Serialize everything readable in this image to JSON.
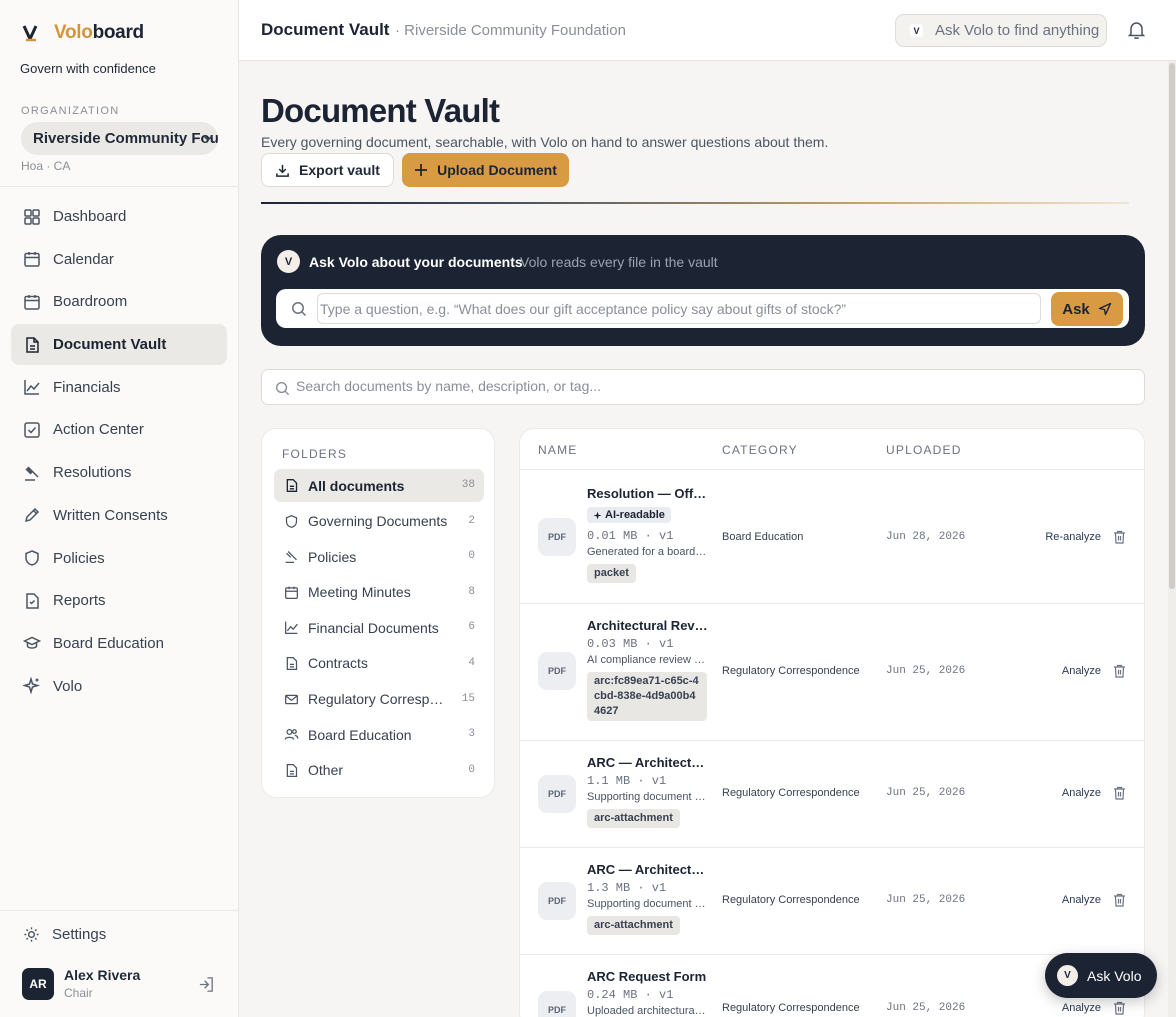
{
  "brand": {
    "name_accent": "Volo",
    "name_rest": "board",
    "tagline": "Govern with confidence"
  },
  "org": {
    "label": "ORGANIZATION",
    "name": "Riverside Community Foundation",
    "sub": "Hoa · CA"
  },
  "nav": [
    {
      "label": "Dashboard",
      "icon": "dashboard-icon"
    },
    {
      "label": "Calendar",
      "icon": "calendar-icon"
    },
    {
      "label": "Boardroom",
      "icon": "boardroom-icon"
    },
    {
      "label": "Document Vault",
      "icon": "document-icon",
      "active": true
    },
    {
      "label": "Financials",
      "icon": "chart-icon"
    },
    {
      "label": "Action Center",
      "icon": "checkbox-icon"
    },
    {
      "label": "Resolutions",
      "icon": "gavel-icon"
    },
    {
      "label": "Written Consents",
      "icon": "pen-icon"
    },
    {
      "label": "Policies",
      "icon": "shield-icon"
    },
    {
      "label": "Reports",
      "icon": "report-icon"
    },
    {
      "label": "Board Education",
      "icon": "graduation-cap-icon"
    },
    {
      "label": "Volo",
      "icon": "sparkle-icon"
    }
  ],
  "settings_label": "Settings",
  "user": {
    "initials": "AR",
    "name": "Alex Rivera",
    "role": "Chair"
  },
  "topbar": {
    "title": "Document Vault",
    "crumb": "· Riverside Community Foundation",
    "search_label": "Ask Volo to find anything",
    "search_badge": "V"
  },
  "page": {
    "title": "Document Vault",
    "subtitle": "Every governing document, searchable, with Volo on hand to answer questions about them.",
    "export_label": "Export vault",
    "upload_label": "Upload Document"
  },
  "ask": {
    "badge": "V",
    "title": "Ask Volo about your documents",
    "hint": "Volo reads every file in the vault",
    "placeholder": "Type a question, e.g. “What does our gift acceptance policy say about gifts of stock?”",
    "button": "Ask"
  },
  "doc_search": {
    "placeholder": "Search documents by name, description, or tag..."
  },
  "folders": {
    "label": "FOLDERS",
    "items": [
      {
        "name": "All documents",
        "count": "38",
        "icon": "document-icon",
        "active": true
      },
      {
        "name": "Governing Documents",
        "count": "2",
        "icon": "shield-icon"
      },
      {
        "name": "Policies",
        "count": "0",
        "icon": "gavel-icon"
      },
      {
        "name": "Meeting Minutes",
        "count": "8",
        "icon": "calendar-icon"
      },
      {
        "name": "Financial Documents",
        "count": "6",
        "icon": "chart-icon"
      },
      {
        "name": "Contracts",
        "count": "4",
        "icon": "document-icon"
      },
      {
        "name": "Regulatory Correspondence",
        "count": "15",
        "icon": "mail-icon"
      },
      {
        "name": "Board Education",
        "count": "3",
        "icon": "people-icon"
      },
      {
        "name": "Other",
        "count": "0",
        "icon": "document-icon"
      }
    ]
  },
  "table": {
    "headers": {
      "name": "NAME",
      "category": "CATEGORY",
      "uploaded": "UPLOADED"
    },
    "file_type": "PDF",
    "rows": [
      {
        "name": "Resolution — Officer Appointments",
        "badge": "AI-readable",
        "meta": "0.01 MB · v1",
        "desc": "Generated for a board packet",
        "tag": "packet",
        "category": "Board Education",
        "date": "Jun 28, 2026",
        "action": "Re-analyze"
      },
      {
        "name": "Architectural Review Submission",
        "meta": "0.03 MB · v1",
        "desc": "AI compliance review of submission",
        "tag": "arc:fc89ea71-c65c-4cbd-838e-4d9a00b44627",
        "category": "Regulatory Correspondence",
        "date": "Jun 25, 2026",
        "action": "Analyze"
      },
      {
        "name": "ARC — Architectural Attachment",
        "meta": "1.1 MB · v1",
        "desc": "Supporting document for ARC request",
        "tag": "arc-attachment",
        "category": "Regulatory Correspondence",
        "date": "Jun 25, 2026",
        "action": "Analyze"
      },
      {
        "name": "ARC — Architectural Attachment",
        "meta": "1.3 MB · v1",
        "desc": "Supporting document for ARC request",
        "tag": "arc-attachment",
        "category": "Regulatory Correspondence",
        "date": "Jun 25, 2026",
        "action": "Analyze"
      },
      {
        "name": "ARC Request Form",
        "meta": "0.24 MB · v1",
        "desc": "Uploaded architectural request",
        "category": "Regulatory Correspondence",
        "date": "Jun 25, 2026",
        "action": "Analyze"
      }
    ]
  },
  "fab": {
    "badge": "V",
    "label": "Ask Volo"
  },
  "colors": {
    "navy": "#1c2433",
    "accent": "#d99a44",
    "sidebar": "#fbfaf8",
    "bg": "#f6f5f3"
  }
}
